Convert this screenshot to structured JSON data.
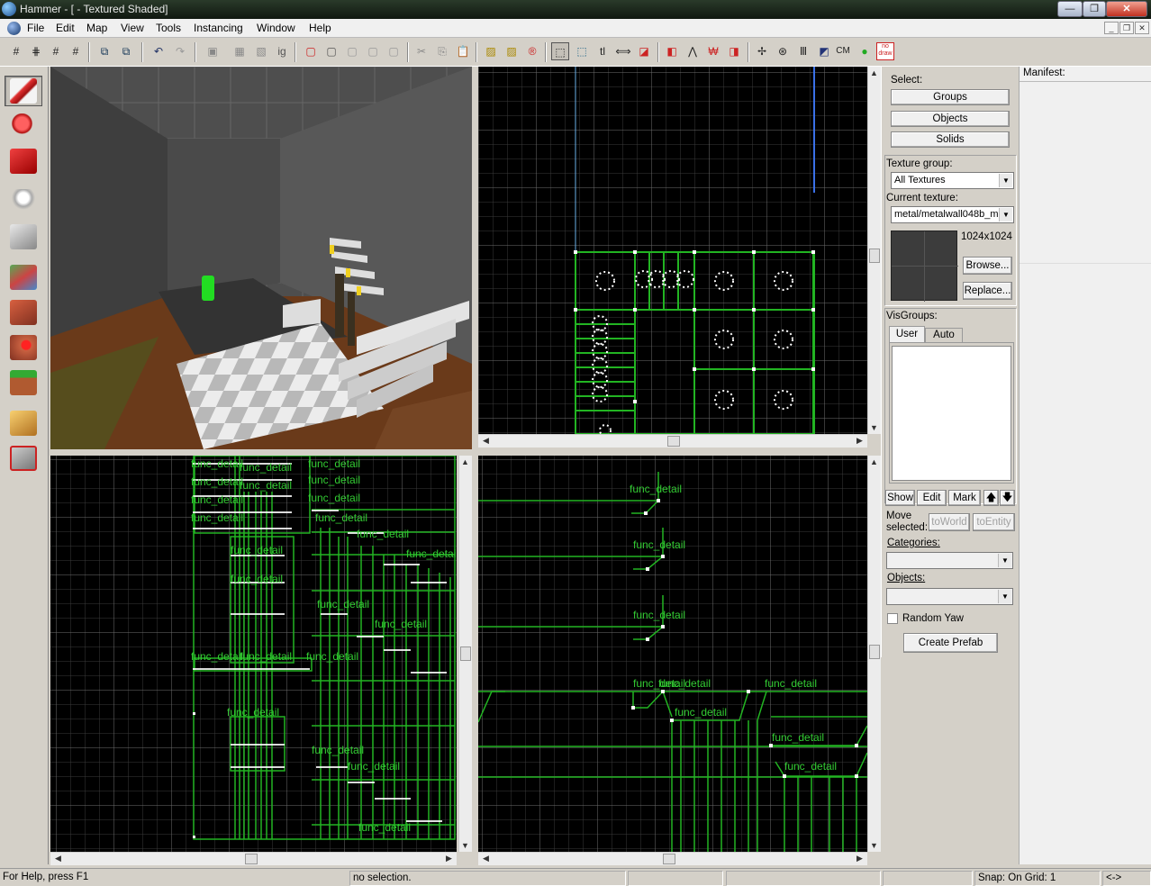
{
  "window": {
    "title": "Hammer - [ - Textured Shaded]",
    "min": "—",
    "max": "❐",
    "close": "✕"
  },
  "menu": {
    "items": [
      "File",
      "Edit",
      "Map",
      "View",
      "Tools",
      "Instancing",
      "Window",
      "Help"
    ],
    "mdi": [
      "_",
      "❐",
      "✕"
    ]
  },
  "toolbar": {
    "texts": [
      "tl",
      "CM",
      "no draw"
    ]
  },
  "viewports": {
    "front_labels": [
      "func_detail",
      "func_detail",
      "func_detail",
      "func_detail",
      "func_detail",
      "func_detail",
      "func_detail",
      "func_detail",
      "func_detail",
      "func_detail",
      "func_detail",
      "func_detail",
      "func_detail",
      "func_detail",
      "func_detail",
      "func_detail",
      "func_detail",
      "func_detail",
      "func_detail",
      "func_detail",
      "func_detail",
      "func_detail",
      "func_detail"
    ],
    "side_labels": [
      "func_detail",
      "func_detail",
      "func_detail",
      "func_detail",
      "func_detail",
      "func_detail",
      "func_detail",
      "func_detail",
      "func_detail"
    ]
  },
  "panel": {
    "select_label": "Select:",
    "groups": "Groups",
    "objects": "Objects",
    "solids": "Solids",
    "texture_group_label": "Texture group:",
    "texture_group_value": "All Textures",
    "current_texture_label": "Current texture:",
    "current_texture_value": "metal/metalwall048b_m",
    "texture_size": "1024x1024",
    "browse": "Browse...",
    "replace": "Replace...",
    "visgroups_label": "VisGroups:",
    "tab_user": "User",
    "tab_auto": "Auto",
    "show": "Show",
    "edit": "Edit",
    "mark": "Mark",
    "up": "🡅",
    "down": "🡇",
    "move_selected_1": "Move",
    "move_selected_2": "selected:",
    "to_world": "toWorld",
    "to_entity": "toEntity",
    "categories_label": "Categories:",
    "objects_label": "Objects:",
    "random_yaw": "Random Yaw",
    "create_prefab": "Create Prefab"
  },
  "manifest": {
    "label": "Manifest:"
  },
  "status": {
    "help": "For Help, press F1",
    "selection": "no selection.",
    "snap": "Snap: On Grid: 1",
    "arrows": "<->"
  },
  "colors": {
    "brush": "#22b422",
    "grid": "#3a3a3a",
    "grid_major": "#6e6e6e",
    "label": "#33cc33"
  }
}
